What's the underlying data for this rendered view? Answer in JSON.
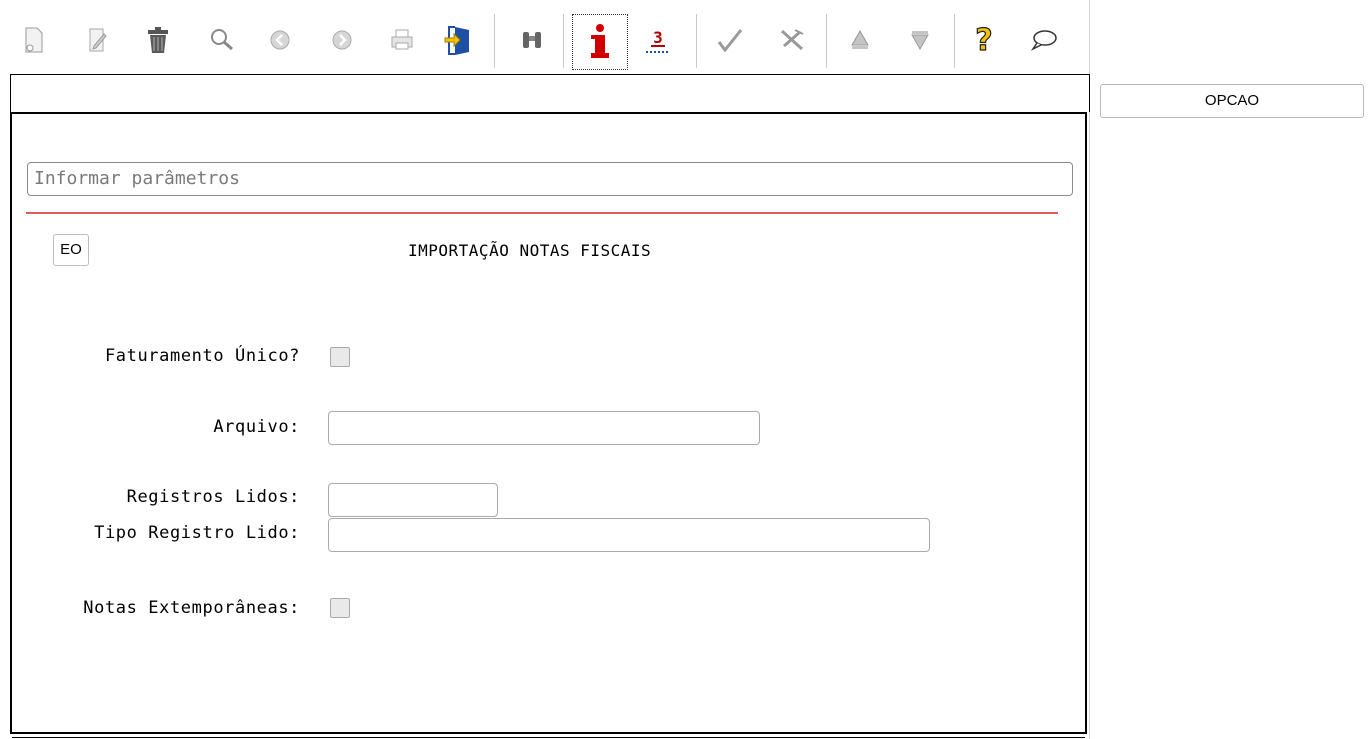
{
  "toolbar": {
    "icons": [
      {
        "name": "new-document-icon"
      },
      {
        "name": "edit-icon"
      },
      {
        "name": "delete-trash-icon"
      },
      {
        "name": "search-magnifier-icon"
      },
      {
        "name": "previous-record-icon"
      },
      {
        "name": "next-record-icon"
      },
      {
        "name": "print-icon"
      },
      {
        "name": "exit-door-icon"
      },
      {
        "name": "binoculars-icon"
      },
      {
        "name": "info-icon"
      },
      {
        "name": "count-records-icon"
      },
      {
        "name": "confirm-check-icon"
      },
      {
        "name": "cancel-icon"
      },
      {
        "name": "navigate-up-icon"
      },
      {
        "name": "navigate-down-icon"
      },
      {
        "name": "help-question-icon"
      },
      {
        "name": "comment-bubble-icon"
      }
    ],
    "count_digit": "3",
    "info_letter": "i"
  },
  "form": {
    "info_placeholder": "Informar parâmetros",
    "eo_label": "EO",
    "title": "IMPORTAÇÃO NOTAS FISCAIS",
    "faturamento_label": "Faturamento Único?",
    "arquivo_label": "Arquivo:",
    "arquivo_value": "",
    "registros_lidos_label": "Registros Lidos:",
    "registros_lidos_value": "",
    "tipo_registro_label": "Tipo Registro Lido:",
    "tipo_registro_value": "",
    "notas_extemporaneas_label": "Notas Extemporâneas:"
  },
  "side": {
    "opcao_label": "OPCAO"
  },
  "colors": {
    "accent_red": "#e05c5c",
    "info_red": "#d00000"
  }
}
